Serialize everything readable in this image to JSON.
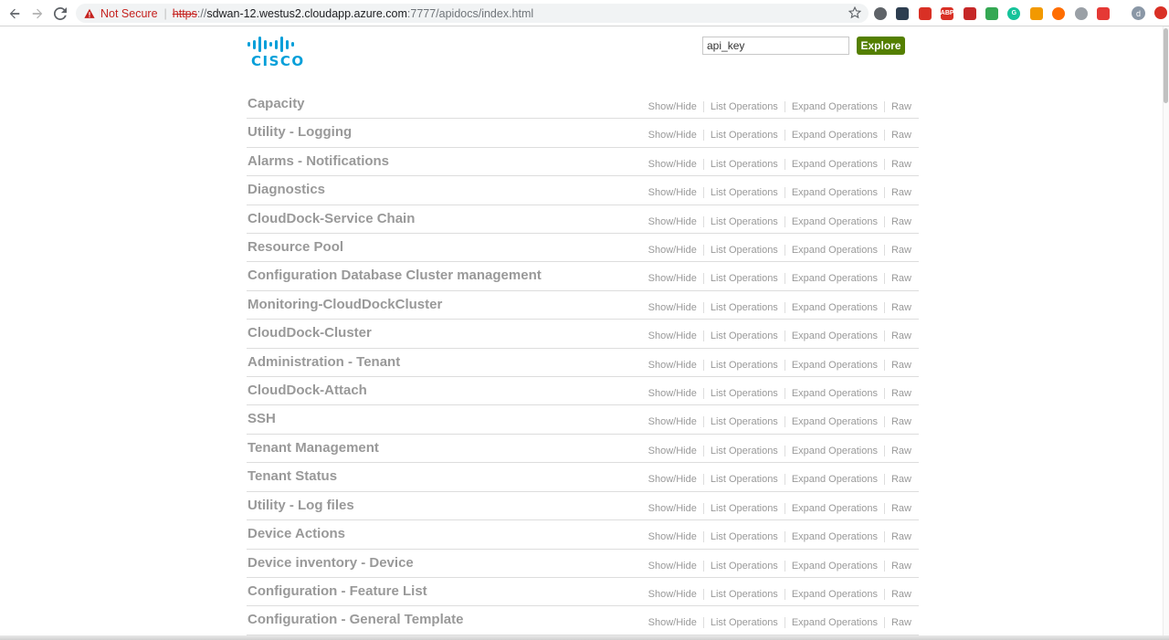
{
  "browser": {
    "security_label": "Not Secure",
    "url_scheme": "https",
    "url_sep": "://",
    "url_host": "sdwan-12.westus2.cloudapp.azure.com",
    "url_path": ":7777/apidocs/index.html",
    "profile_initial": "d",
    "extensions": [
      {
        "name": "extension-circle-icon",
        "color": "#5f6368",
        "text": ""
      },
      {
        "name": "extension-terminal-icon",
        "color": "#2d3e50",
        "text": ""
      },
      {
        "name": "extension-shield-red-icon",
        "color": "#d93025",
        "text": ""
      },
      {
        "name": "extension-abp-icon",
        "color": "#d93025",
        "text": "ABP"
      },
      {
        "name": "extension-square-red-icon",
        "color": "#c62828",
        "text": ""
      },
      {
        "name": "extension-check-green-icon",
        "color": "#34a853",
        "text": ""
      },
      {
        "name": "extension-grammarly-icon",
        "color": "#15c39a",
        "text": "G"
      },
      {
        "name": "extension-orange-square-icon",
        "color": "#f29900",
        "text": ""
      },
      {
        "name": "extension-orange-circle-icon",
        "color": "#ff6d00",
        "text": ""
      },
      {
        "name": "extension-outline-circle-icon",
        "color": "#9aa0a6",
        "text": ""
      },
      {
        "name": "extension-pin-red-icon",
        "color": "#e53935",
        "text": ""
      }
    ]
  },
  "header": {
    "logo_text": "CISCO",
    "api_key_value": "api_key",
    "explore_label": "Explore"
  },
  "ops_labels": {
    "show_hide": "Show/Hide",
    "list": "List Operations",
    "expand": "Expand Operations",
    "raw": "Raw"
  },
  "resources": [
    "Capacity",
    "Utility - Logging",
    "Alarms - Notifications",
    "Diagnostics",
    "CloudDock-Service Chain",
    "Resource Pool",
    "Configuration Database Cluster management",
    "Monitoring-CloudDockCluster",
    "CloudDock-Cluster",
    "Administration - Tenant",
    "CloudDock-Attach",
    "SSH",
    "Tenant Management",
    "Tenant Status",
    "Utility - Log files",
    "Device Actions",
    "Device inventory - Device",
    "Configuration - Feature List",
    "Configuration - General Template"
  ],
  "colors": {
    "accent": "#547f00",
    "cisco_blue": "#049fd9",
    "resource_text": "#999999"
  }
}
